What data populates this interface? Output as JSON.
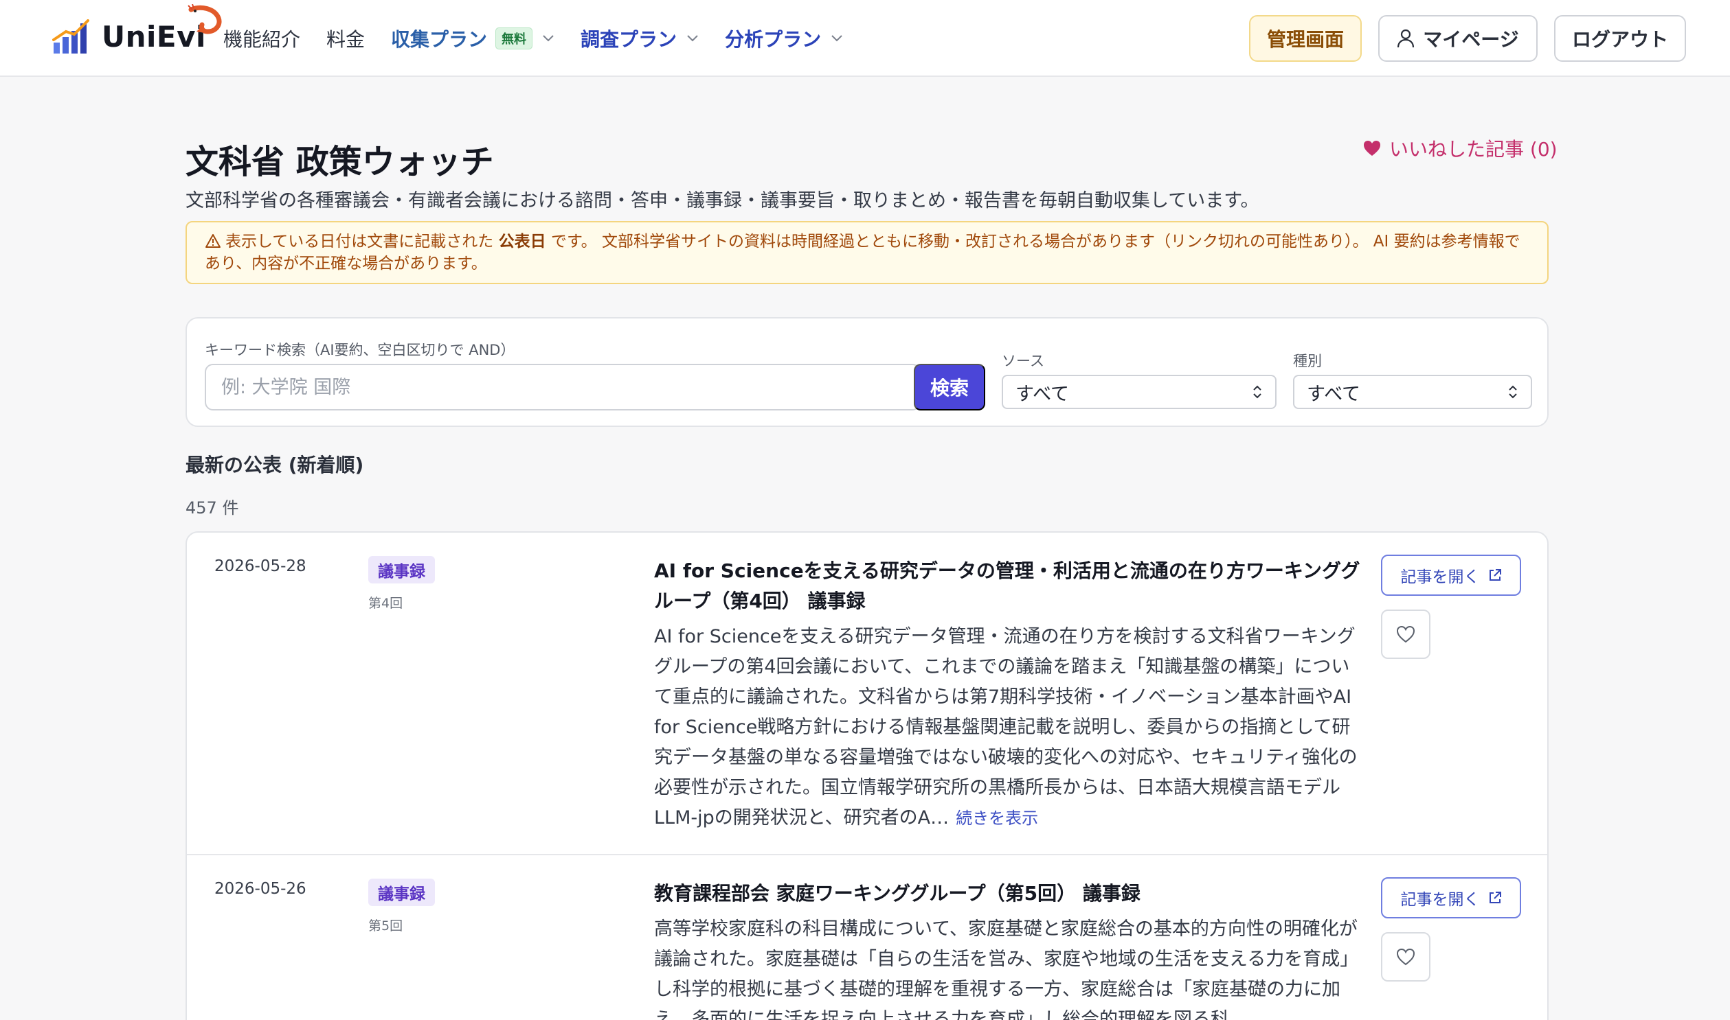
{
  "header": {
    "brand": "UniEvi",
    "nav": [
      {
        "label": "機能紹介"
      },
      {
        "label": "料金"
      },
      {
        "label": "収集プラン",
        "badge": "無料"
      },
      {
        "label": "調査プラン"
      },
      {
        "label": "分析プラン"
      }
    ],
    "admin_label": "管理画面",
    "mypage_label": "マイページ",
    "logout_label": "ログアウト"
  },
  "page": {
    "title": "文科省 政策ウォッチ",
    "liked_label": "いいねした記事 (0)",
    "description": "文部科学省の各種審議会・有識者会議における諮問・答申・議事録・議事要旨・取りまとめ・報告書を毎朝自動収集しています。",
    "notice": {
      "prefix": "表示している日付は文書に記載された",
      "bold": "公表日",
      "suffix": "です。 文部科学省サイトの資料は時間経過とともに移動・改訂される場合があります（リンク切れの可能性あり）。 AI 要約は参考情報であり、内容が不正確な場合があります。"
    }
  },
  "search": {
    "keyword_label": "キーワード検索（AI要約、空白区切りで AND）",
    "keyword_placeholder": "例: 大学院 国際",
    "button_label": "検索",
    "source_label": "ソース",
    "source_value": "すべて",
    "type_label": "種別",
    "type_value": "すべて"
  },
  "list": {
    "section_title": "最新の公表 (新着順)",
    "count": "457 件",
    "open_label": "記事を開く",
    "more_label": "続きを表示",
    "items": [
      {
        "date": "2026-05-28",
        "type": "議事録",
        "session": "第4回",
        "title": "AI for Scienceを支える研究データの管理・利活用と流通の在り方ワーキンググループ（第4回） 議事録",
        "summary": "AI for Scienceを支える研究データ管理・流通の在り方を検討する文科省ワーキンググループの第4回会議において、これまでの議論を踏まえ「知識基盤の構築」について重点的に議論された。文科省からは第7期科学技術・イノベーション基本計画やAI for Science戦略方針における情報基盤関連記載を説明し、委員からの指摘として研究データ基盤の単なる容量増強ではない破壊的変化への対応や、セキュリティ強化の必要性が示された。国立情報学研究所の黒橋所長からは、日本語大規模言語モデルLLM-jpの開発状況と、研究者のA…"
      },
      {
        "date": "2026-05-26",
        "type": "議事録",
        "session": "第5回",
        "title": "教育課程部会 家庭ワーキンググループ（第5回） 議事録",
        "summary": "高等学校家庭科の科目構成について、家庭基礎と家庭総合の基本的方向性の明確化が議論された。家庭基礎は「自らの生活を営み、家庭や地域の生活を支える力を育成」し科学的根拠に基づく基礎的理解を重視する一方、家庭総合は「家庭基礎の力に加え、多面的に生活を捉え向上させる力を育成」し総合的理解を図る科"
      }
    ]
  },
  "colors": {
    "accent": "#4b46d8",
    "plan_nav": "#2b43b8",
    "like": "#c42f6b",
    "notice_bg": "#fffbea",
    "badge_bg": "#ede8fb"
  }
}
